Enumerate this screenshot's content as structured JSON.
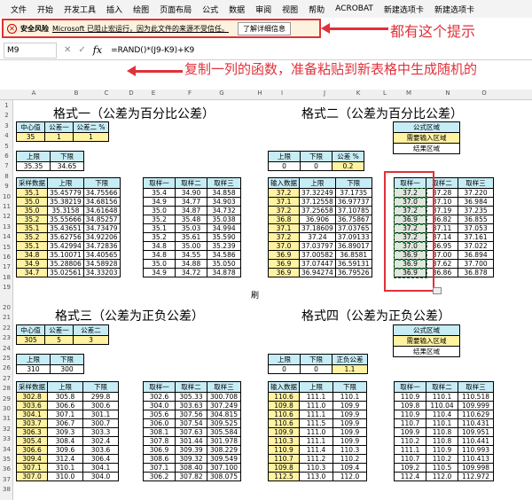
{
  "menu": [
    "文件",
    "开始",
    "开发工具",
    "插入",
    "绘图",
    "页面布局",
    "公式",
    "数据",
    "审阅",
    "视图",
    "帮助",
    "ACROBAT",
    "新建选项卡",
    "新建选项卡"
  ],
  "warning": {
    "title": "安全风险",
    "text": "Microsoft 已阻止宏运行，因为此文件的来源不受信任。",
    "button": "了解详细信息"
  },
  "annotations": {
    "top": "都有这个提示",
    "middle": "复制一列的函数，准备粘贴到新表格中生成随机的"
  },
  "formula_bar": {
    "name_box": "M9",
    "formula": "=RAND()*(J9-K9)+K9"
  },
  "columns": [
    "A",
    "B",
    "C",
    "D",
    "E",
    "F",
    "G",
    "H",
    "I",
    "J",
    "K",
    "L",
    "M",
    "N",
    "O"
  ],
  "rows": [
    "1",
    "2",
    "3",
    "4",
    "5",
    "6",
    "7",
    "8",
    "9",
    "10",
    "11",
    "12",
    "13",
    "14",
    "15",
    "16",
    "17",
    "18",
    "19",
    "20",
    "21",
    "22",
    "23",
    "24",
    "25",
    "26",
    "27",
    "28",
    "29",
    "30",
    "31",
    "32",
    "33",
    "34",
    "35",
    "36",
    "37",
    "38"
  ],
  "legend": {
    "title": "公式区域",
    "input": "需要输入区域",
    "result": "结果区域"
  },
  "p1": {
    "title": "格式一（公差为百分比公差）",
    "hdr": [
      "中心值",
      "公差一",
      "公差二 %"
    ],
    "vals": [
      "35",
      "1",
      "1"
    ],
    "lim_hdr": [
      "上限",
      "下限"
    ],
    "lim": [
      "35.35",
      "34.65"
    ],
    "data_hdr": [
      "采样数据",
      "上限",
      "下限"
    ],
    "data": [
      [
        "35.1",
        "35.45779",
        "34.75566"
      ],
      [
        "35.0",
        "35.38219",
        "34.68156"
      ],
      [
        "35.0",
        "35.3158",
        "34.61648"
      ],
      [
        "35.2",
        "35.55666",
        "34.85257"
      ],
      [
        "35.1",
        "35.43651",
        "34.73479"
      ],
      [
        "35.2",
        "35.62756",
        "34.92206"
      ],
      [
        "35.1",
        "35.42994",
        "34.72836"
      ],
      [
        "34.8",
        "35.10071",
        "34.40565"
      ],
      [
        "34.9",
        "35.28806",
        "34.58928"
      ],
      [
        "34.7",
        "35.02561",
        "34.33203"
      ]
    ],
    "samp_hdr": [
      "取样一",
      "取样二",
      "取样三"
    ],
    "samp": [
      [
        "35.4",
        "34.90",
        "34.858"
      ],
      [
        "34.9",
        "34.77",
        "34.903"
      ],
      [
        "35.0",
        "34.87",
        "34.732"
      ],
      [
        "35.2",
        "35.48",
        "35.038"
      ],
      [
        "35.1",
        "35.03",
        "34.994"
      ],
      [
        "35.2",
        "35.61",
        "35.590"
      ],
      [
        "34.8",
        "35.00",
        "35.239"
      ],
      [
        "34.8",
        "34.55",
        "34.586"
      ],
      [
        "35.0",
        "34.88",
        "35.050"
      ],
      [
        "34.9",
        "34.72",
        "34.878"
      ]
    ]
  },
  "p2": {
    "title": "格式二（公差为百分比公差）",
    "lim_hdr": [
      "上限",
      "下限",
      "公差 %"
    ],
    "lim": [
      "0",
      "0",
      "0.2"
    ],
    "data_hdr": [
      "输入数据",
      "上限",
      "下限"
    ],
    "data": [
      [
        "37.2",
        "37.32249",
        "37.1735"
      ],
      [
        "37.1",
        "37.12558",
        "36.97737"
      ],
      [
        "37.2",
        "37.25658",
        "37.10785"
      ],
      [
        "36.8",
        "36.906",
        "36.75867"
      ],
      [
        "37.1",
        "37.18609",
        "37.03765"
      ],
      [
        "37.2",
        "37.24",
        "37.09133"
      ],
      [
        "37.0",
        "37.03797",
        "36.89017"
      ],
      [
        "36.9",
        "37.00582",
        "36.8581"
      ],
      [
        "36.9",
        "37.07447",
        "36.59131"
      ],
      [
        "36.9",
        "36.94274",
        "36.79526"
      ]
    ],
    "samp_hdr": [
      "取样一",
      "取样二",
      "取样三"
    ],
    "samp": [
      [
        "37.2",
        "37.28",
        "37.220"
      ],
      [
        "37.0",
        "37.10",
        "36.984"
      ],
      [
        "37.2",
        "37.19",
        "37.235"
      ],
      [
        "36.9",
        "36.82",
        "36.855"
      ],
      [
        "37.2",
        "37.11",
        "37.053"
      ],
      [
        "37.2",
        "37.14",
        "37.161"
      ],
      [
        "37.0",
        "36.95",
        "37.022"
      ],
      [
        "36.9",
        "37.00",
        "36.894"
      ],
      [
        "36.9",
        "37.62",
        "37.700"
      ],
      [
        "36.9",
        "36.86",
        "36.878"
      ]
    ]
  },
  "p3": {
    "title": "格式三（公差为正负公差）",
    "hdr": [
      "中心值",
      "公差一",
      "公差二"
    ],
    "vals": [
      "305",
      "5",
      "3"
    ],
    "lim_hdr": [
      "上限",
      "下限"
    ],
    "lim": [
      "310",
      "300"
    ],
    "data_hdr": [
      "采样数据",
      "上限",
      "下限"
    ],
    "data": [
      [
        "302.8",
        "305.8",
        "299.8"
      ],
      [
        "303.6",
        "306.6",
        "300.6"
      ],
      [
        "304.1",
        "307.1",
        "301.1"
      ],
      [
        "303.7",
        "306.7",
        "300.7"
      ],
      [
        "306.3",
        "309.3",
        "303.3"
      ],
      [
        "305.4",
        "308.4",
        "302.4"
      ],
      [
        "306.6",
        "309.6",
        "303.6"
      ],
      [
        "309.4",
        "312.4",
        "306.4"
      ],
      [
        "307.1",
        "310.1",
        "304.1"
      ],
      [
        "307.0",
        "310.0",
        "304.0"
      ]
    ],
    "samp_hdr": [
      "取样一",
      "取样二",
      "取样三"
    ],
    "samp": [
      [
        "302.6",
        "305.33",
        "300.708"
      ],
      [
        "304.0",
        "303.63",
        "307.249"
      ],
      [
        "305.6",
        "307.56",
        "304.815"
      ],
      [
        "306.0",
        "307.54",
        "309.525"
      ],
      [
        "308.1",
        "307.63",
        "305.584"
      ],
      [
        "307.8",
        "301.44",
        "301.978"
      ],
      [
        "306.9",
        "309.39",
        "308.229"
      ],
      [
        "308.6",
        "309.32",
        "309.549"
      ],
      [
        "307.1",
        "308.40",
        "307.100"
      ],
      [
        "306.2",
        "307.82",
        "308.075"
      ]
    ]
  },
  "p4": {
    "title": "格式四（公差为正负公差）",
    "lim_hdr": [
      "上限",
      "下限",
      "正负公差"
    ],
    "lim": [
      "0",
      "0",
      "1.1"
    ],
    "data_hdr": [
      "输入数据",
      "上限",
      "下限"
    ],
    "data": [
      [
        "110.6",
        "111.1",
        "110.1"
      ],
      [
        "109.8",
        "111.0",
        "109.9"
      ],
      [
        "110.6",
        "111.1",
        "109.9"
      ],
      [
        "110.6",
        "111.5",
        "109.9"
      ],
      [
        "109.9",
        "111.0",
        "109.9"
      ],
      [
        "110.3",
        "111.1",
        "109.9"
      ],
      [
        "110.9",
        "111.4",
        "110.3"
      ],
      [
        "110.7",
        "111.2",
        "110.2"
      ],
      [
        "109.8",
        "110.3",
        "109.4"
      ],
      [
        "112.5",
        "113.0",
        "112.0"
      ]
    ],
    "samp_hdr": [
      "取样一",
      "取样二",
      "取样三"
    ],
    "samp": [
      [
        "110.9",
        "110.1",
        "110.518"
      ],
      [
        "109.8",
        "110.04",
        "109.999"
      ],
      [
        "110.9",
        "110.4",
        "110.629"
      ],
      [
        "110.7",
        "110.1",
        "110.431"
      ],
      [
        "109.9",
        "110.8",
        "109.951"
      ],
      [
        "110.2",
        "110.8",
        "110.441"
      ],
      [
        "111.1",
        "110.9",
        "110.993"
      ],
      [
        "110.7",
        "110.2",
        "110.413"
      ],
      [
        "109.2",
        "110.5",
        "109.998"
      ],
      [
        "112.4",
        "112.0",
        "112.972"
      ]
    ]
  },
  "colors": {
    "accent": "#e0313a",
    "yellow": "#fff2a0",
    "cyan": "#c6ecf5"
  }
}
